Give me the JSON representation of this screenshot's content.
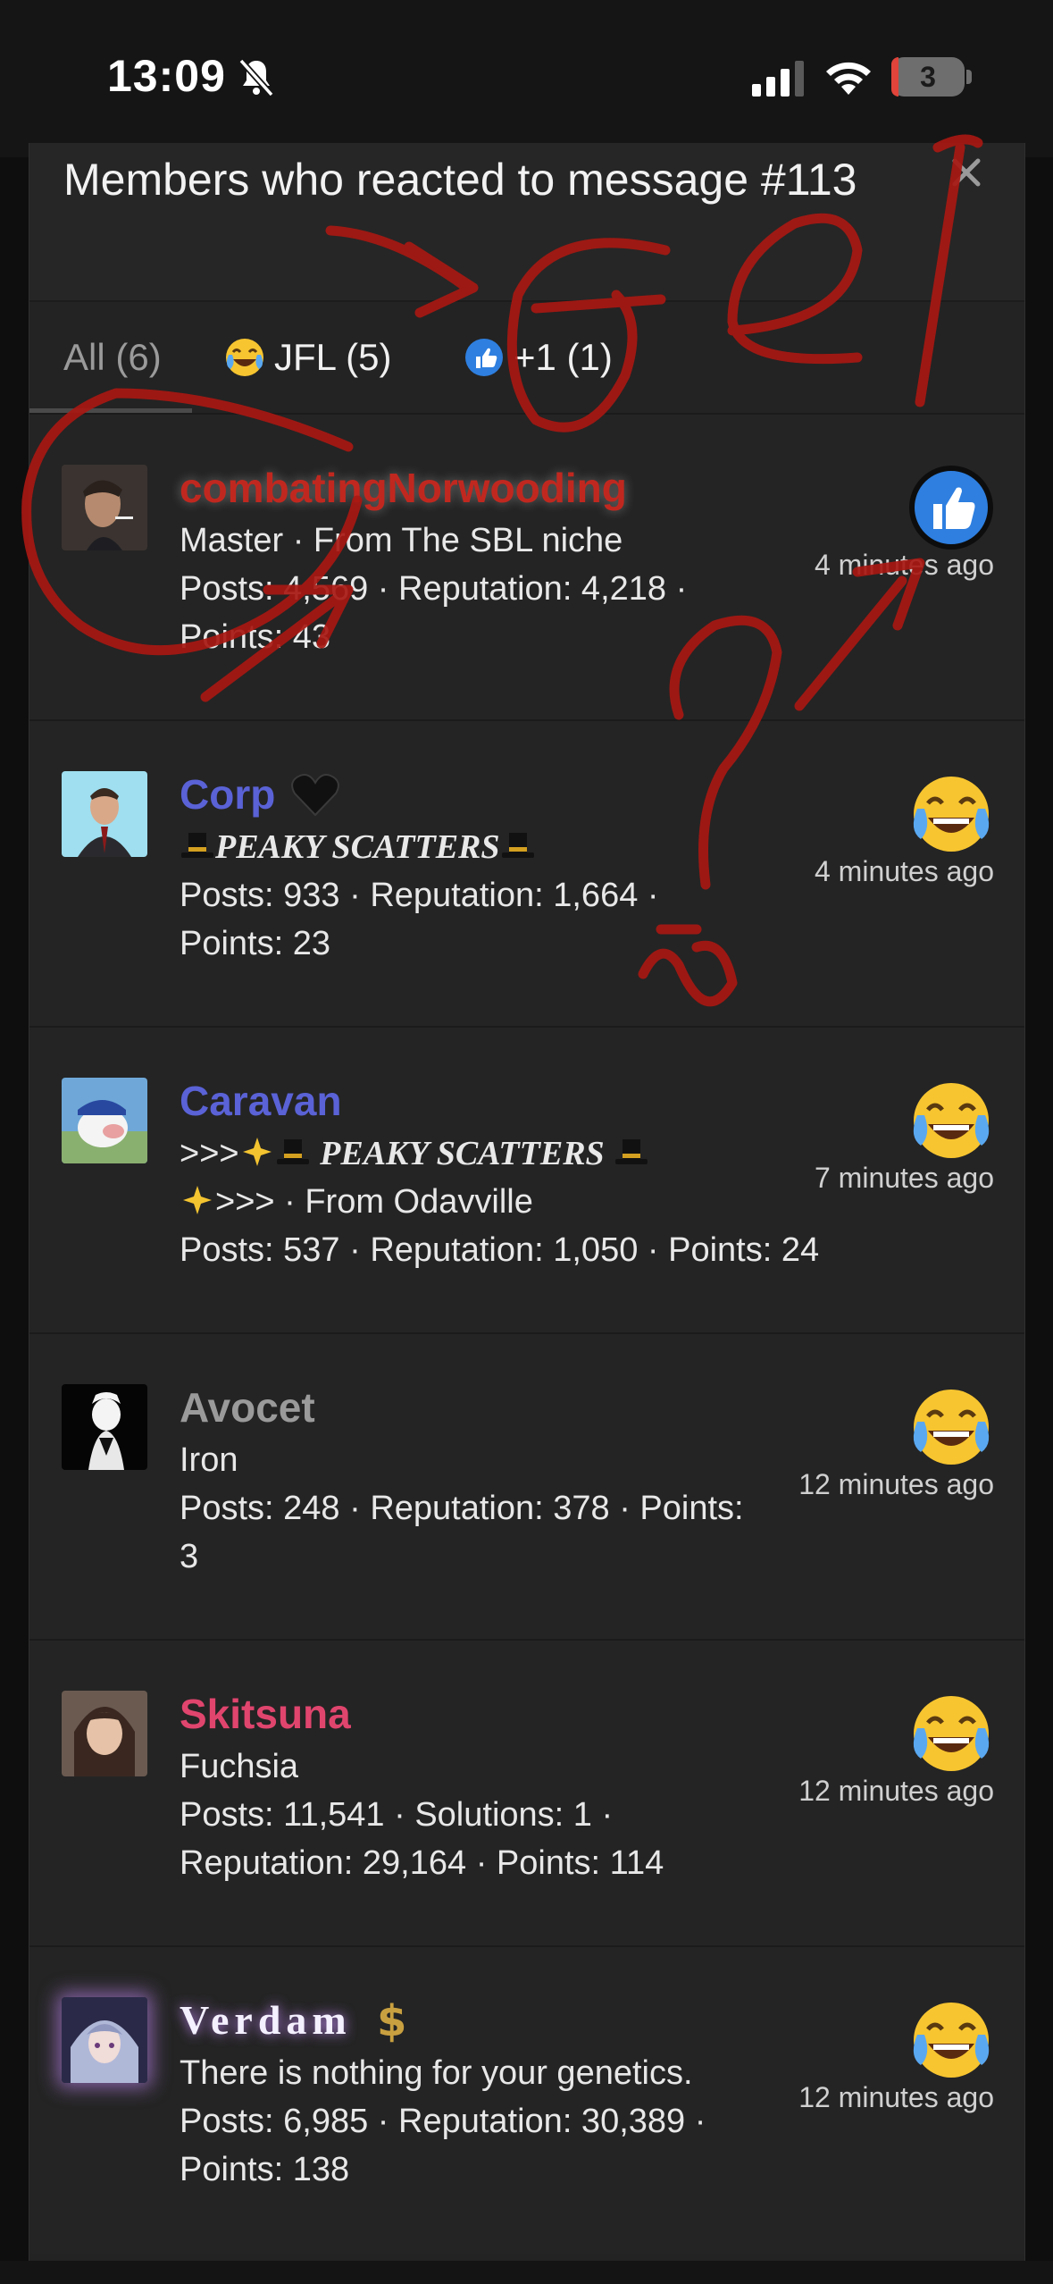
{
  "status_bar": {
    "time": "13:09",
    "battery": "3"
  },
  "modal": {
    "title": "Members who reacted to message #113",
    "tabs": [
      {
        "label": "All (6)",
        "icon": "none"
      },
      {
        "label": "JFL (5)",
        "icon": "joy-emoji"
      },
      {
        "label": "+1 (1)",
        "icon": "thumbs-up"
      }
    ]
  },
  "members": [
    {
      "name": "combatingNorwooding",
      "name_color": "#c0281f",
      "title": "Master · From The SBL niche",
      "stats_line1": "Posts: 4,569 · Reputation: 4,218 ·",
      "stats_line2": "Points: 43",
      "reaction": "thumbs-up",
      "time": "4 minutes ago"
    },
    {
      "name": "Corp",
      "name_color": "#5a62d6",
      "title_text": "PEAKY SCATTERS",
      "stats_line1": "Posts: 933 · Reputation: 1,664 ·",
      "stats_line2": "Points: 23",
      "reaction": "joy-emoji",
      "time": "4 minutes ago"
    },
    {
      "name": "Caravan",
      "name_color": "#5a62d6",
      "title_prefix": ">>>",
      "title_text": "PEAKY SCATTERS",
      "title_suffix": ">>> · From Odavville",
      "stats_line1": "Posts: 537 · Reputation: 1,050 · Points: 24",
      "reaction": "joy-emoji",
      "time": "7 minutes ago"
    },
    {
      "name": "Avocet",
      "name_color": "#9a9a9a",
      "title": "Iron",
      "stats_line1": "Posts: 248 · Reputation: 378 · Points:",
      "stats_line2": "3",
      "reaction": "joy-emoji",
      "time": "12 minutes ago"
    },
    {
      "name": "Skitsuna",
      "name_color": "#e0456e",
      "title": "Fuchsia",
      "stats_line1": "Posts: 11,541 · Solutions: 1 ·",
      "stats_line2": "Reputation: 29,164 · Points: 114",
      "reaction": "joy-emoji",
      "time": "12 minutes ago"
    },
    {
      "name": "Verdam",
      "name_color": "#f4f0ff",
      "title": "There is nothing for your genetics.",
      "stats_line1": "Posts: 6,985 · Reputation: 30,389 ·",
      "stats_line2": "Points: 138",
      "reaction": "joy-emoji",
      "time": "12 minutes ago"
    }
  ],
  "colors": {
    "background": "#232323",
    "annotation_ink": "#b01a14"
  }
}
